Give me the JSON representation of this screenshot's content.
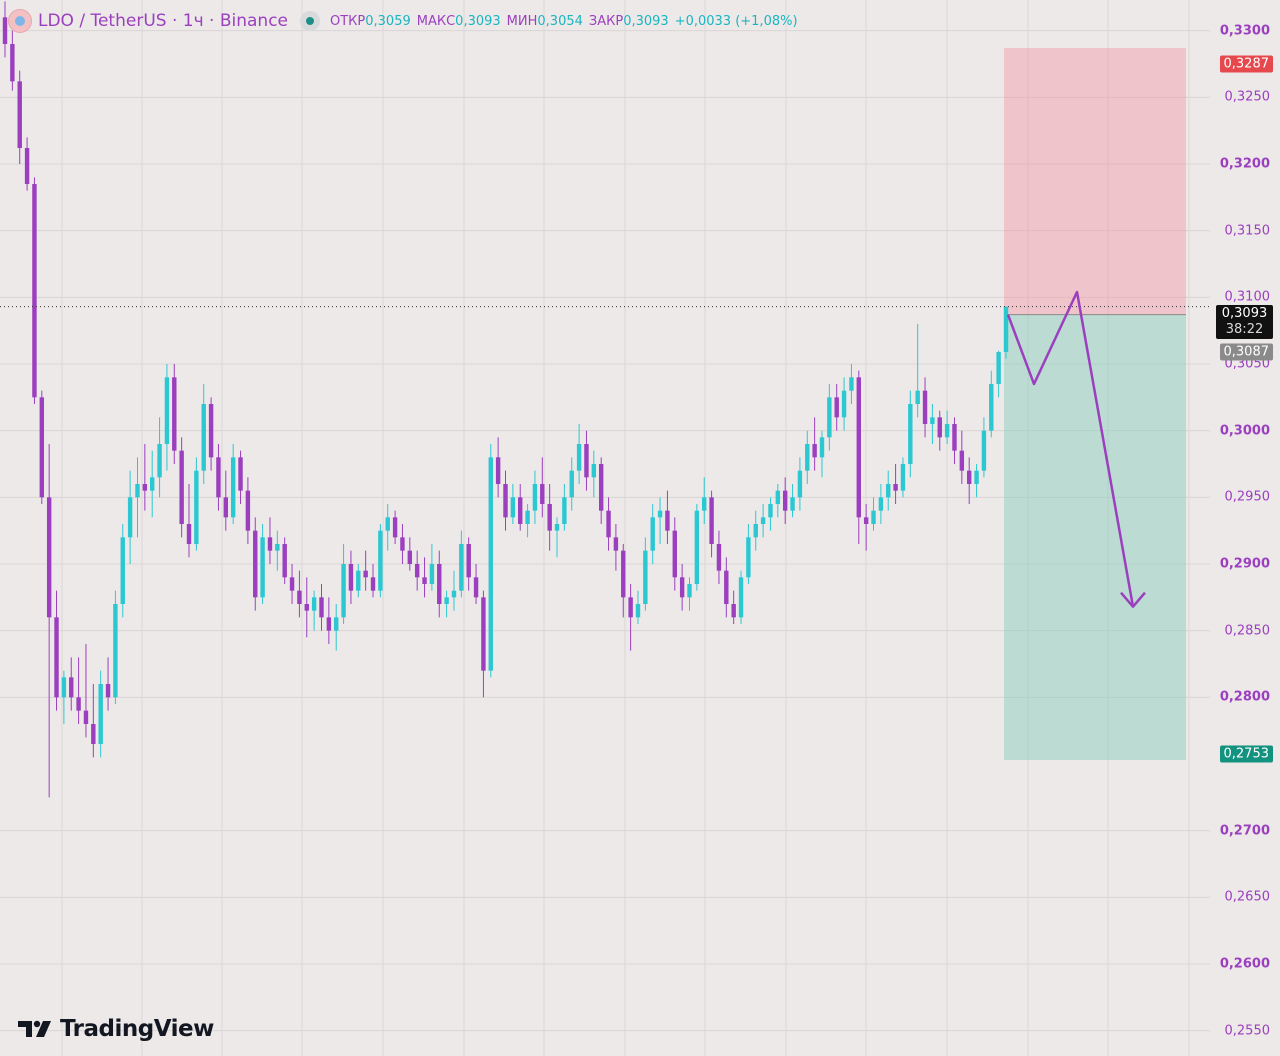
{
  "header": {
    "symbol": "LDO / TetherUS · 1ч · Binance",
    "open_label": "ОТКР",
    "open_value": "0,3059",
    "high_label": "МАКС",
    "high_value": "0,3093",
    "low_label": "МИН",
    "low_value": "0,3054",
    "close_label": "ЗАКР",
    "close_value": "0,3093",
    "change": "+0,0033 (+1,08%)"
  },
  "price_tags": {
    "stop": "0,3287",
    "last_price": "0,3093",
    "countdown": "38:22",
    "entry": "0,3087",
    "target": "0,2753"
  },
  "colors": {
    "background": "#ede9e9",
    "candle_up": "#2bc8d2",
    "candle_down": "#9b3fbf",
    "axis_text": "#9b3fbf",
    "stop_zone": "#f28b9a",
    "target_zone": "#7fc9b8",
    "stop_tag": "#e5484d",
    "target_tag": "#13927f"
  },
  "brand": {
    "name": "TradingView"
  },
  "chart_data": {
    "type": "candlestick",
    "title": "LDO / TetherUS · 1ч · Binance",
    "y_axis": {
      "ticks": [
        "0,3300",
        "0,3250",
        "0,3200",
        "0,3150",
        "0,3100",
        "0,3050",
        "0,3000",
        "0,2950",
        "0,2900",
        "0,2850",
        "0,2800",
        "0,2700",
        "0,2650",
        "0,2600",
        "0,2550"
      ],
      "bold_ticks": [
        "0,3300",
        "0,3200",
        "0,3000",
        "0,2900",
        "0,2800",
        "0,2700",
        "0,2600"
      ],
      "range": [
        0.2531,
        0.3323
      ],
      "grid": true
    },
    "position": {
      "side": "short",
      "entry": 0.3087,
      "stop": 0.3287,
      "target": 0.2753
    },
    "last_price": 0.3093,
    "projection_path": [
      0.3087,
      0.3035,
      0.3104,
      0.2868
    ],
    "candles": [
      [
        0.331,
        0.3322,
        0.328,
        0.329
      ],
      [
        0.329,
        0.33,
        0.3255,
        0.3262
      ],
      [
        0.3262,
        0.327,
        0.32,
        0.3212
      ],
      [
        0.3212,
        0.322,
        0.318,
        0.3185
      ],
      [
        0.3185,
        0.319,
        0.302,
        0.3025
      ],
      [
        0.3025,
        0.303,
        0.2945,
        0.295
      ],
      [
        0.295,
        0.299,
        0.2725,
        0.286
      ],
      [
        0.286,
        0.288,
        0.279,
        0.28
      ],
      [
        0.28,
        0.282,
        0.278,
        0.2815
      ],
      [
        0.2815,
        0.283,
        0.279,
        0.28
      ],
      [
        0.28,
        0.283,
        0.278,
        0.279
      ],
      [
        0.279,
        0.284,
        0.277,
        0.278
      ],
      [
        0.278,
        0.281,
        0.2755,
        0.2765
      ],
      [
        0.2765,
        0.282,
        0.2755,
        0.281
      ],
      [
        0.281,
        0.283,
        0.279,
        0.28
      ],
      [
        0.28,
        0.288,
        0.2795,
        0.287
      ],
      [
        0.287,
        0.293,
        0.286,
        0.292
      ],
      [
        0.292,
        0.297,
        0.29,
        0.295
      ],
      [
        0.295,
        0.298,
        0.292,
        0.296
      ],
      [
        0.296,
        0.299,
        0.294,
        0.2955
      ],
      [
        0.2955,
        0.2985,
        0.2935,
        0.2965
      ],
      [
        0.2965,
        0.301,
        0.295,
        0.299
      ],
      [
        0.299,
        0.305,
        0.297,
        0.304
      ],
      [
        0.304,
        0.305,
        0.2975,
        0.2985
      ],
      [
        0.2985,
        0.2995,
        0.292,
        0.293
      ],
      [
        0.293,
        0.296,
        0.2905,
        0.2915
      ],
      [
        0.2915,
        0.298,
        0.291,
        0.297
      ],
      [
        0.297,
        0.3035,
        0.296,
        0.302
      ],
      [
        0.302,
        0.3025,
        0.297,
        0.298
      ],
      [
        0.298,
        0.299,
        0.294,
        0.295
      ],
      [
        0.295,
        0.297,
        0.2925,
        0.2935
      ],
      [
        0.2935,
        0.299,
        0.293,
        0.298
      ],
      [
        0.298,
        0.2985,
        0.2945,
        0.2955
      ],
      [
        0.2955,
        0.2965,
        0.2915,
        0.2925
      ],
      [
        0.2925,
        0.2935,
        0.2865,
        0.2875
      ],
      [
        0.2875,
        0.293,
        0.287,
        0.292
      ],
      [
        0.292,
        0.2935,
        0.29,
        0.291
      ],
      [
        0.291,
        0.2925,
        0.2895,
        0.2915
      ],
      [
        0.2915,
        0.292,
        0.2885,
        0.289
      ],
      [
        0.289,
        0.29,
        0.287,
        0.288
      ],
      [
        0.288,
        0.2895,
        0.286,
        0.287
      ],
      [
        0.287,
        0.289,
        0.2845,
        0.2865
      ],
      [
        0.2865,
        0.288,
        0.285,
        0.2875
      ],
      [
        0.2875,
        0.2885,
        0.285,
        0.286
      ],
      [
        0.286,
        0.2875,
        0.284,
        0.285
      ],
      [
        0.285,
        0.287,
        0.2835,
        0.286
      ],
      [
        0.286,
        0.2915,
        0.2855,
        0.29
      ],
      [
        0.29,
        0.291,
        0.287,
        0.288
      ],
      [
        0.288,
        0.29,
        0.2875,
        0.2895
      ],
      [
        0.2895,
        0.291,
        0.288,
        0.289
      ],
      [
        0.289,
        0.29,
        0.2875,
        0.288
      ],
      [
        0.288,
        0.293,
        0.2875,
        0.2925
      ],
      [
        0.2925,
        0.2945,
        0.291,
        0.2935
      ],
      [
        0.2935,
        0.294,
        0.2915,
        0.292
      ],
      [
        0.292,
        0.293,
        0.29,
        0.291
      ],
      [
        0.291,
        0.292,
        0.2895,
        0.29
      ],
      [
        0.29,
        0.291,
        0.288,
        0.289
      ],
      [
        0.289,
        0.2905,
        0.2875,
        0.2885
      ],
      [
        0.2885,
        0.2915,
        0.288,
        0.29
      ],
      [
        0.29,
        0.291,
        0.286,
        0.287
      ],
      [
        0.287,
        0.288,
        0.286,
        0.2875
      ],
      [
        0.2875,
        0.2895,
        0.2865,
        0.288
      ],
      [
        0.288,
        0.2925,
        0.2875,
        0.2915
      ],
      [
        0.2915,
        0.292,
        0.288,
        0.289
      ],
      [
        0.289,
        0.29,
        0.287,
        0.2875
      ],
      [
        0.2875,
        0.288,
        0.28,
        0.282
      ],
      [
        0.282,
        0.299,
        0.2815,
        0.298
      ],
      [
        0.298,
        0.2995,
        0.295,
        0.296
      ],
      [
        0.296,
        0.297,
        0.2925,
        0.2935
      ],
      [
        0.2935,
        0.296,
        0.293,
        0.295
      ],
      [
        0.295,
        0.296,
        0.2925,
        0.293
      ],
      [
        0.293,
        0.2945,
        0.292,
        0.294
      ],
      [
        0.294,
        0.297,
        0.293,
        0.296
      ],
      [
        0.296,
        0.298,
        0.2935,
        0.2945
      ],
      [
        0.2945,
        0.296,
        0.291,
        0.2925
      ],
      [
        0.2925,
        0.2935,
        0.2905,
        0.293
      ],
      [
        0.293,
        0.296,
        0.2925,
        0.295
      ],
      [
        0.295,
        0.298,
        0.294,
        0.297
      ],
      [
        0.297,
        0.3005,
        0.296,
        0.299
      ],
      [
        0.299,
        0.3,
        0.2955,
        0.2965
      ],
      [
        0.2965,
        0.2985,
        0.295,
        0.2975
      ],
      [
        0.2975,
        0.298,
        0.293,
        0.294
      ],
      [
        0.294,
        0.295,
        0.291,
        0.292
      ],
      [
        0.292,
        0.293,
        0.2895,
        0.291
      ],
      [
        0.291,
        0.2915,
        0.286,
        0.2875
      ],
      [
        0.2875,
        0.2885,
        0.2835,
        0.286
      ],
      [
        0.286,
        0.288,
        0.2855,
        0.287
      ],
      [
        0.287,
        0.292,
        0.2865,
        0.291
      ],
      [
        0.291,
        0.2945,
        0.29,
        0.2935
      ],
      [
        0.2935,
        0.295,
        0.2915,
        0.294
      ],
      [
        0.294,
        0.2955,
        0.2915,
        0.2925
      ],
      [
        0.2925,
        0.2935,
        0.288,
        0.289
      ],
      [
        0.289,
        0.29,
        0.2865,
        0.2875
      ],
      [
        0.2875,
        0.289,
        0.2865,
        0.2885
      ],
      [
        0.2885,
        0.2945,
        0.288,
        0.294
      ],
      [
        0.294,
        0.2965,
        0.293,
        0.295
      ],
      [
        0.295,
        0.2955,
        0.2905,
        0.2915
      ],
      [
        0.2915,
        0.2925,
        0.2885,
        0.2895
      ],
      [
        0.2895,
        0.2905,
        0.286,
        0.287
      ],
      [
        0.287,
        0.288,
        0.2855,
        0.286
      ],
      [
        0.286,
        0.2895,
        0.2855,
        0.289
      ],
      [
        0.289,
        0.293,
        0.2885,
        0.292
      ],
      [
        0.292,
        0.294,
        0.291,
        0.293
      ],
      [
        0.293,
        0.2945,
        0.292,
        0.2935
      ],
      [
        0.2935,
        0.295,
        0.2925,
        0.2945
      ],
      [
        0.2945,
        0.296,
        0.2935,
        0.2955
      ],
      [
        0.2955,
        0.2965,
        0.293,
        0.294
      ],
      [
        0.294,
        0.296,
        0.2935,
        0.295
      ],
      [
        0.295,
        0.298,
        0.294,
        0.297
      ],
      [
        0.297,
        0.3,
        0.296,
        0.299
      ],
      [
        0.299,
        0.301,
        0.297,
        0.298
      ],
      [
        0.298,
        0.3,
        0.2965,
        0.2995
      ],
      [
        0.2995,
        0.3035,
        0.2985,
        0.3025
      ],
      [
        0.3025,
        0.3035,
        0.3,
        0.301
      ],
      [
        0.301,
        0.304,
        0.3,
        0.303
      ],
      [
        0.303,
        0.305,
        0.302,
        0.304
      ],
      [
        0.304,
        0.3045,
        0.2915,
        0.2935
      ],
      [
        0.2935,
        0.2945,
        0.291,
        0.293
      ],
      [
        0.293,
        0.295,
        0.2925,
        0.294
      ],
      [
        0.294,
        0.296,
        0.293,
        0.295
      ],
      [
        0.295,
        0.297,
        0.294,
        0.296
      ],
      [
        0.296,
        0.2975,
        0.2945,
        0.2955
      ],
      [
        0.2955,
        0.298,
        0.295,
        0.2975
      ],
      [
        0.2975,
        0.303,
        0.2965,
        0.302
      ],
      [
        0.302,
        0.308,
        0.301,
        0.303
      ],
      [
        0.303,
        0.304,
        0.2995,
        0.3005
      ],
      [
        0.3005,
        0.302,
        0.299,
        0.301
      ],
      [
        0.301,
        0.3015,
        0.2985,
        0.2995
      ],
      [
        0.2995,
        0.3015,
        0.299,
        0.3005
      ],
      [
        0.3005,
        0.301,
        0.2975,
        0.2985
      ],
      [
        0.2985,
        0.3,
        0.296,
        0.297
      ],
      [
        0.297,
        0.298,
        0.2945,
        0.296
      ],
      [
        0.296,
        0.2975,
        0.295,
        0.297
      ],
      [
        0.297,
        0.301,
        0.2965,
        0.3
      ],
      [
        0.3,
        0.3045,
        0.2995,
        0.3035
      ],
      [
        0.3035,
        0.306,
        0.3025,
        0.3059
      ],
      [
        0.3059,
        0.3093,
        0.3054,
        0.3093
      ]
    ]
  }
}
